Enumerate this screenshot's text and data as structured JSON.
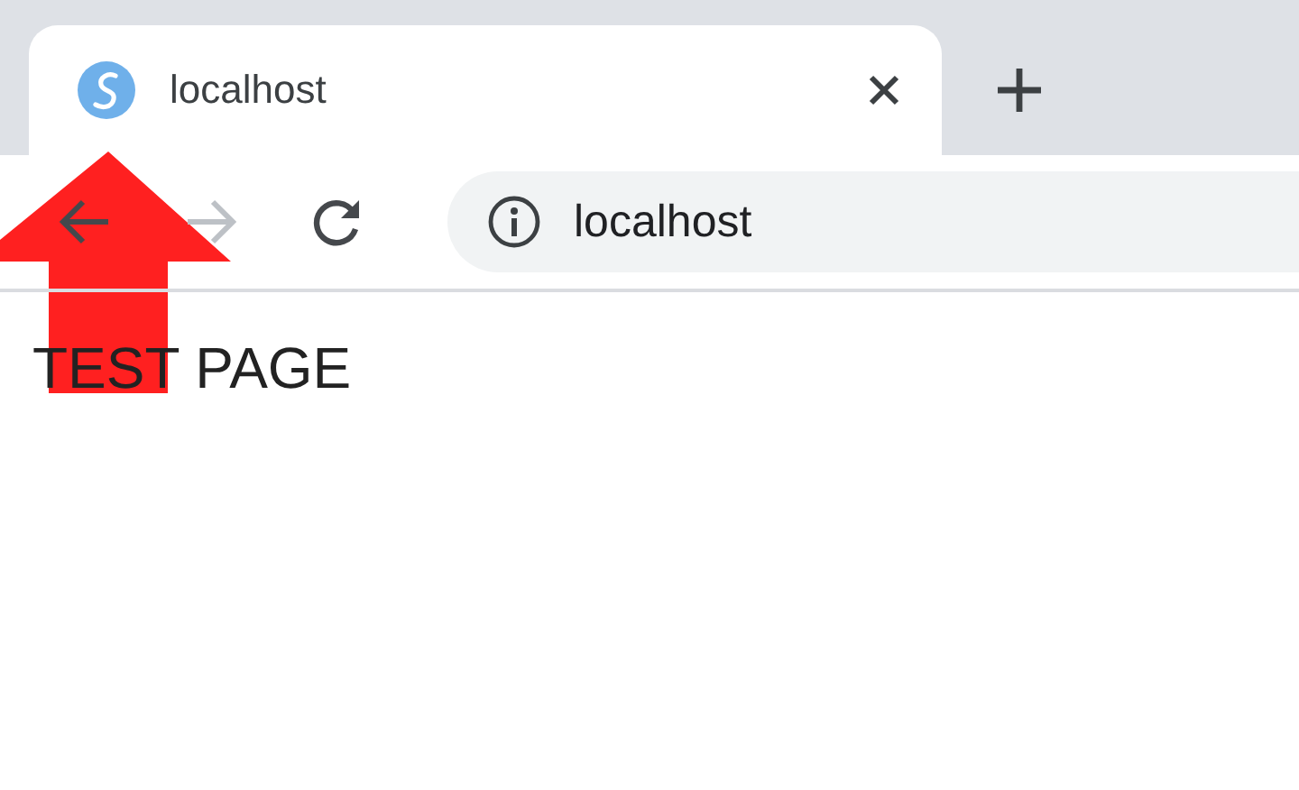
{
  "tabs": [
    {
      "title": "localhost",
      "selected": true
    }
  ],
  "navigation": [
    {
      "kind": "back",
      "disabled": false
    },
    {
      "kind": "forward",
      "disabled": true
    },
    {
      "kind": "reload",
      "disabled": false
    }
  ],
  "address_bar": {
    "url": "localhost"
  },
  "page": {
    "heading": "TEST PAGE"
  },
  "annotation": {
    "kind": "arrow"
  }
}
